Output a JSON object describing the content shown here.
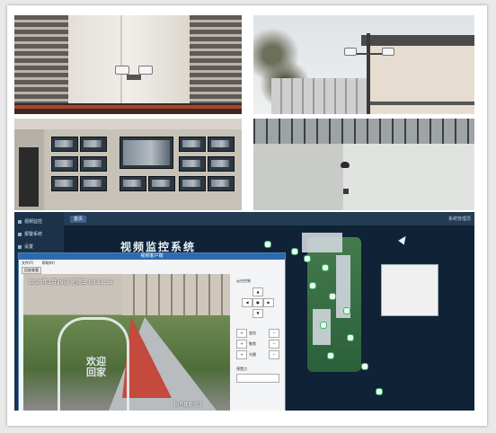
{
  "photos": {
    "wall_cameras": {},
    "pole_cameras": {},
    "control_room": {},
    "dome_camera": {}
  },
  "software": {
    "sidebar": {
      "items": [
        {
          "label": "视频监控"
        },
        {
          "label": "报警系统"
        },
        {
          "label": "设置"
        }
      ]
    },
    "topbar": {
      "tab_label": "首页",
      "corner_text": "系统管理员"
    },
    "map_title": "视频监控系统",
    "video_window": {
      "title": "视频客户端",
      "menu": [
        "文件(F)",
        "帮助(H)"
      ],
      "button": "回放查看",
      "osd_date": "2020年1月29日  星期三  09:51:36",
      "osd_camera": "10号楼单元门",
      "gate_text": "欢迎回家",
      "ptz": {
        "title": "云台控制",
        "zoom": "变倍",
        "focus": "聚焦",
        "iris": "光圈",
        "preset": "预置点"
      }
    }
  }
}
